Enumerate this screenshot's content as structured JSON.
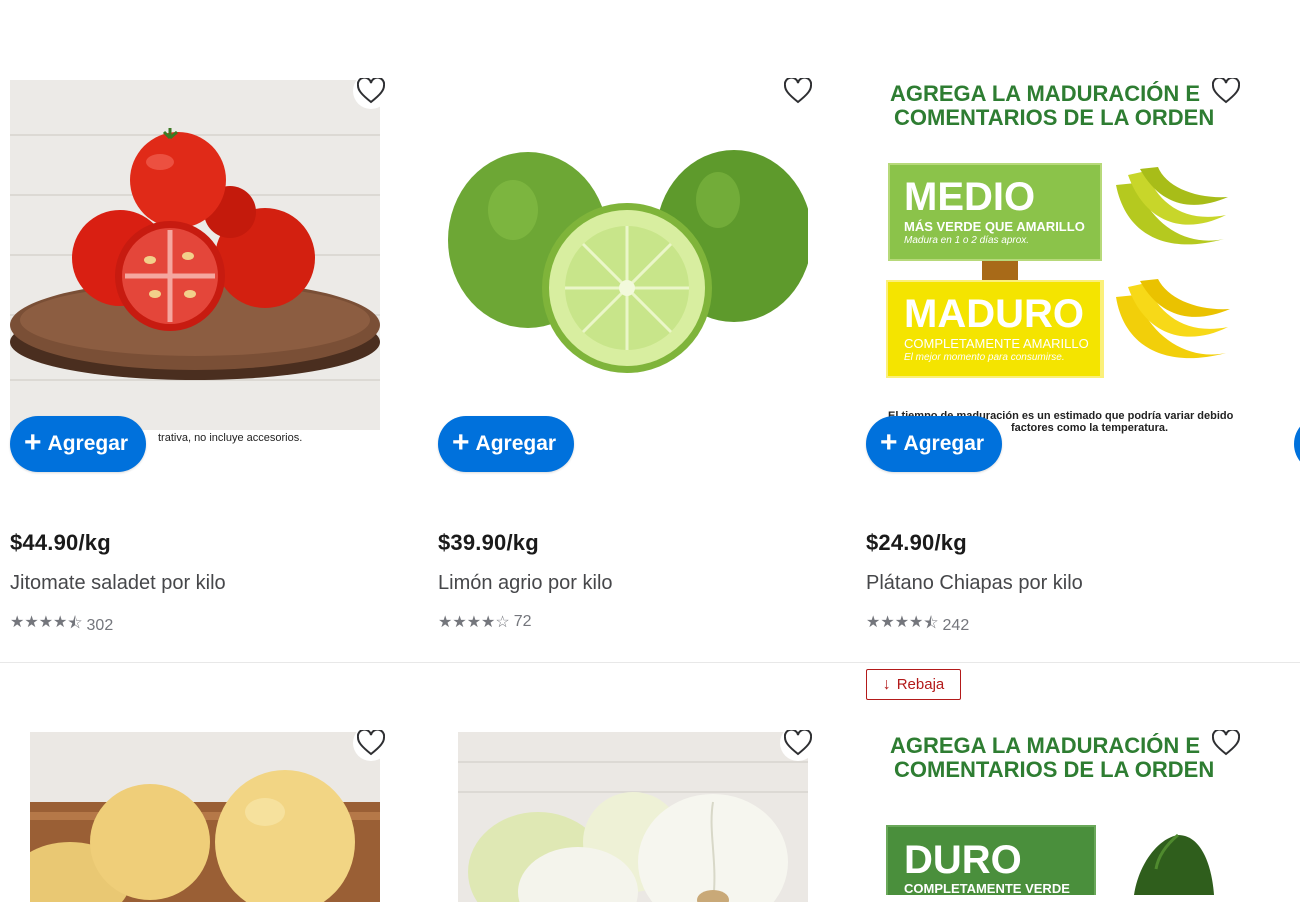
{
  "products": [
    {
      "price": "$44.90/kg",
      "name": "Jitomate saladet por kilo",
      "stars": 4.5,
      "reviews": "302",
      "add_label": "Agregar",
      "caption": "trativa, no incluye accesorios."
    },
    {
      "price": "$39.90/kg",
      "name": "Limón agrio por kilo",
      "stars": 4,
      "reviews": "72",
      "add_label": "Agregar"
    },
    {
      "price": "$24.90/kg",
      "name": "Plátano Chiapas por kilo",
      "stars": 4.5,
      "reviews": "242",
      "add_label": "Agregar"
    }
  ],
  "banana_banner": {
    "heading_line1": "AGREGA LA MADURACIÓN E",
    "heading_line2": "COMENTARIOS DE LA ORDEN",
    "level1_title": "MEDIO",
    "level1_sub": "MÁS VERDE QUE AMARILLO",
    "level1_note": "Madura en 1 o 2 días aprox.",
    "level2_title": "MADURO",
    "level2_sub": "COMPLETAMENTE AMARILLO",
    "level2_note": "El mejor momento para consumirse.",
    "footnote_line1": "El tiempo de maduración es un estimado que podría variar debido",
    "footnote_line2": "factores como la temperatura."
  },
  "avocado_banner": {
    "heading_line1": "AGREGA LA MADURACIÓN E",
    "heading_line2": "COMENTARIOS DE LA ORDEN",
    "level1_title": "DURO",
    "level1_sub": "COMPLETAMENTE VERDE"
  },
  "sale_badge": {
    "label": "Rebaja"
  },
  "colors": {
    "primary": "#0071dc",
    "sale": "#b31a1a",
    "banner_green": "#2e7d32",
    "medio_green": "#8bc34a",
    "maduro_yellow": "#f4e400",
    "duro_green": "#4a8f3c"
  }
}
